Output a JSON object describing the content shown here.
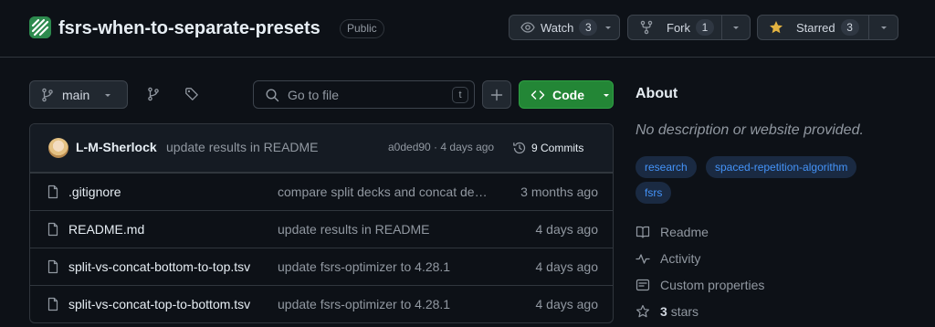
{
  "repo": {
    "name": "fsrs-when-to-separate-presets",
    "visibility": "Public"
  },
  "header_actions": {
    "watch": {
      "label": "Watch",
      "count": "3"
    },
    "fork": {
      "label": "Fork",
      "count": "1"
    },
    "star": {
      "label": "Starred",
      "count": "3"
    }
  },
  "toolbar": {
    "branch": "main",
    "search_placeholder": "Go to file",
    "search_shortcut": "t",
    "code_label": "Code"
  },
  "latest_commit": {
    "author": "L-M-Sherlock",
    "message": "update results in README",
    "hash_time": "a0ded90 · 4 days ago",
    "commits_label": "9 Commits"
  },
  "files": [
    {
      "name": ".gitignore",
      "message": "compare split decks and concat decks",
      "date": "3 months ago"
    },
    {
      "name": "README.md",
      "message": "update results in README",
      "date": "4 days ago"
    },
    {
      "name": "split-vs-concat-bottom-to-top.tsv",
      "message": "update fsrs-optimizer to 4.28.1",
      "date": "4 days ago"
    },
    {
      "name": "split-vs-concat-top-to-bottom.tsv",
      "message": "update fsrs-optimizer to 4.28.1",
      "date": "4 days ago"
    }
  ],
  "about": {
    "title": "About",
    "description": "No description or website provided.",
    "topics": [
      "research",
      "spaced-repetition-algorithm",
      "fsrs"
    ],
    "links": {
      "readme": "Readme",
      "activity": "Activity",
      "custom_properties": "Custom properties",
      "stars_count": "3",
      "stars_label": "stars"
    }
  },
  "colors": {
    "background": "#0d1117",
    "accent_green": "#238636",
    "link_blue": "#4493f8",
    "star_yellow": "#e3b341"
  },
  "icons": [
    "repo-logo-icon",
    "eye-icon",
    "fork-icon",
    "star-icon",
    "branch-icon",
    "tag-icon",
    "search-icon",
    "plus-icon",
    "code-icon",
    "history-icon",
    "file-icon",
    "book-icon",
    "pulse-icon",
    "note-icon"
  ]
}
